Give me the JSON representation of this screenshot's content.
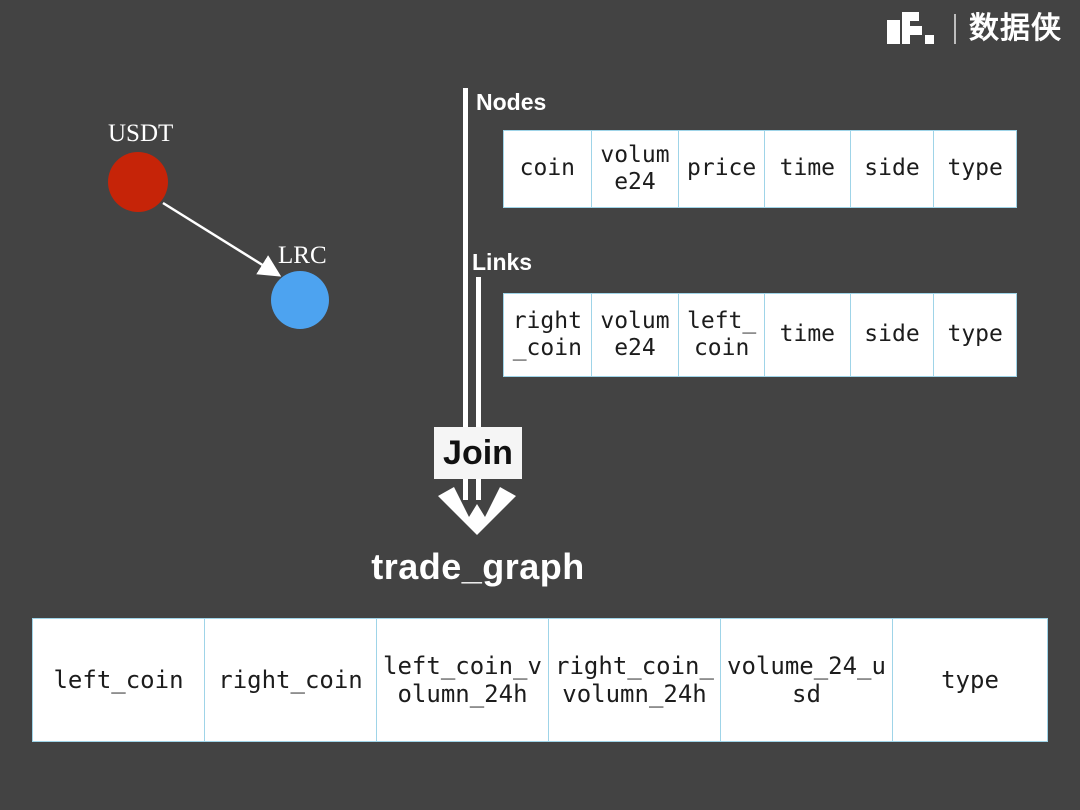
{
  "brand": {
    "logo_text": "dt.",
    "logo_icon": "dt-logo-icon",
    "name_cn": "数据侠"
  },
  "graph": {
    "nodes": [
      {
        "label": "USDT",
        "color": "#c62408"
      },
      {
        "label": "LRC",
        "color": "#4da3f0"
      }
    ],
    "edge": {
      "from": "USDT",
      "to": "LRC",
      "color": "#ffffff"
    }
  },
  "flow": {
    "nodes_label": "Nodes",
    "links_label": "Links",
    "join_label": "Join",
    "result_title": "trade_graph",
    "arrow_color": "#ffffff"
  },
  "tables": {
    "nodes": {
      "name": "Nodes",
      "columns": [
        "coin",
        "volume24",
        "price",
        "time",
        "side",
        "type"
      ],
      "widths": [
        88,
        88,
        86,
        86,
        84,
        82
      ],
      "border_color": "#9fd4e8",
      "cell_bg": "#ffffff"
    },
    "links": {
      "name": "Links",
      "columns": [
        "right_coin",
        "volume24",
        "left_coin",
        "time",
        "side",
        "type"
      ],
      "widths": [
        88,
        88,
        86,
        86,
        84,
        82
      ],
      "border_color": "#9fd4e8",
      "cell_bg": "#ffffff"
    },
    "result": {
      "name": "trade_graph",
      "columns": [
        "left_coin",
        "right_coin",
        "left_coin_volumn_24h",
        "right_coin_volumn_24h",
        "volume_24_usd",
        "type"
      ],
      "widths": [
        172,
        172,
        172,
        172,
        172,
        156
      ],
      "border_color": "#9fd4e8",
      "cell_bg": "#ffffff"
    }
  },
  "colors": {
    "background": "#434343",
    "text_light": "#ffffff",
    "text_dark": "#1c1c1c",
    "badge_bg": "#f5f5f5"
  }
}
